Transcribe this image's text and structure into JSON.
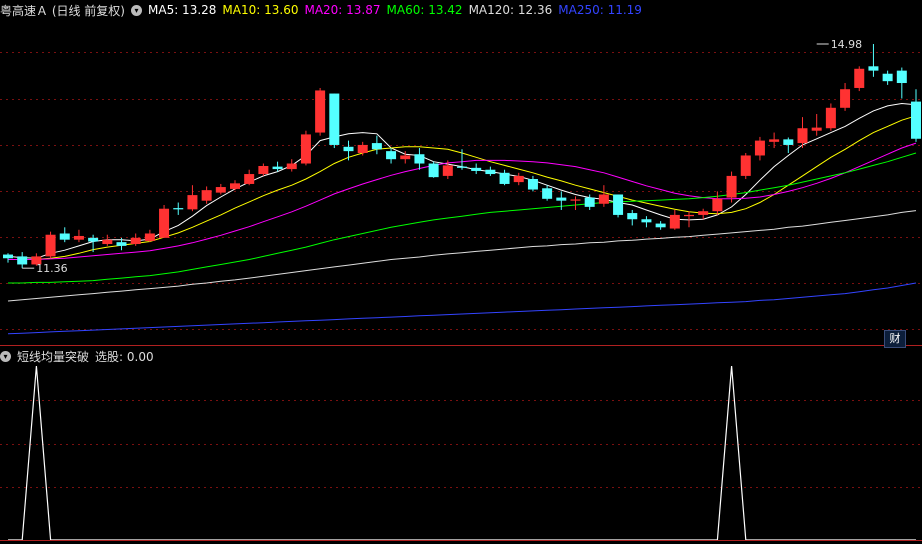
{
  "main_header": {
    "title": "粤高速Ａ (日线 前复权)",
    "ma_labels": [
      {
        "text": "MA5: 13.28",
        "color": "#ffffff"
      },
      {
        "text": "MA10: 13.60",
        "color": "#ffff00"
      },
      {
        "text": "MA20: 13.87",
        "color": "#ff00ff"
      },
      {
        "text": "MA60: 13.42",
        "color": "#00ff00"
      },
      {
        "text": "MA120: 12.36",
        "color": "#dddddd"
      },
      {
        "text": "MA250: 11.19",
        "color": "#3344ff"
      }
    ]
  },
  "sub_header": {
    "title": "短线均量突破",
    "value_text": "选股: 0.00"
  },
  "fin_tag": "财",
  "chart_data": [
    {
      "type": "candlestick",
      "ylim": [
        10.2,
        15.4
      ],
      "colors": {
        "up": "#ff3232",
        "down": "#54ffff",
        "flat": "#ffffff"
      },
      "annotations": [
        {
          "text": "11.36",
          "index": 1,
          "value": 11.36
        },
        {
          "text": "14.98",
          "index": 57,
          "value": 14.98
        }
      ],
      "candles": [
        [
          11.58,
          11.52,
          11.6,
          11.45
        ],
        [
          11.55,
          11.42,
          11.62,
          11.36
        ],
        [
          11.42,
          11.55,
          11.6,
          11.4
        ],
        [
          11.55,
          11.9,
          11.95,
          11.52
        ],
        [
          11.92,
          11.82,
          12.02,
          11.78
        ],
        [
          11.82,
          11.88,
          11.98,
          11.78
        ],
        [
          11.85,
          11.79,
          11.9,
          11.62
        ],
        [
          11.75,
          11.82,
          11.9,
          11.72
        ],
        [
          11.78,
          11.72,
          11.85,
          11.65
        ],
        [
          11.75,
          11.85,
          11.92,
          11.72
        ],
        [
          11.8,
          11.92,
          11.98,
          11.78
        ],
        [
          11.85,
          12.32,
          12.38,
          11.85
        ],
        [
          12.33,
          12.31,
          12.42,
          12.22
        ],
        [
          12.31,
          12.54,
          12.7,
          12.28
        ],
        [
          12.45,
          12.62,
          12.68,
          12.4
        ],
        [
          12.58,
          12.67,
          12.72,
          12.55
        ],
        [
          12.64,
          12.73,
          12.78,
          12.62
        ],
        [
          12.72,
          12.88,
          12.95,
          12.7
        ],
        [
          12.88,
          13.01,
          13.05,
          12.85
        ],
        [
          13.0,
          12.96,
          13.08,
          12.92
        ],
        [
          12.96,
          13.05,
          13.12,
          12.92
        ],
        [
          13.05,
          13.52,
          13.58,
          13.02
        ],
        [
          13.55,
          14.23,
          14.27,
          13.5
        ],
        [
          14.18,
          13.35,
          14.18,
          13.3
        ],
        [
          13.32,
          13.25,
          13.42,
          13.1
        ],
        [
          13.22,
          13.35,
          13.4,
          13.18
        ],
        [
          13.38,
          13.28,
          13.5,
          13.2
        ],
        [
          13.25,
          13.12,
          13.3,
          13.05
        ],
        [
          13.12,
          13.18,
          13.25,
          13.05
        ],
        [
          13.2,
          13.05,
          13.3,
          12.95
        ],
        [
          13.05,
          12.83,
          13.08,
          12.82
        ],
        [
          12.85,
          13.02,
          13.1,
          12.8
        ],
        [
          13.0,
          12.98,
          13.28,
          12.95
        ],
        [
          12.98,
          12.93,
          13.05,
          12.88
        ],
        [
          12.95,
          12.88,
          13.0,
          12.85
        ],
        [
          12.9,
          12.72,
          12.95,
          12.7
        ],
        [
          12.75,
          12.85,
          12.9,
          12.7
        ],
        [
          12.8,
          12.63,
          12.85,
          12.6
        ],
        [
          12.65,
          12.48,
          12.7,
          12.45
        ],
        [
          12.5,
          12.45,
          12.6,
          12.3
        ],
        [
          12.45,
          12.47,
          12.52,
          12.3
        ],
        [
          12.5,
          12.35,
          12.55,
          12.3
        ],
        [
          12.4,
          12.55,
          12.7,
          12.35
        ],
        [
          12.55,
          12.22,
          12.55,
          12.18
        ],
        [
          12.25,
          12.15,
          12.3,
          12.05
        ],
        [
          12.15,
          12.1,
          12.2,
          12.02
        ],
        [
          12.08,
          12.02,
          12.12,
          11.98
        ],
        [
          12.0,
          12.22,
          12.3,
          11.98
        ],
        [
          12.2,
          12.22,
          12.28,
          12.02
        ],
        [
          12.22,
          12.28,
          12.32,
          12.15
        ],
        [
          12.28,
          12.48,
          12.6,
          12.22
        ],
        [
          12.5,
          12.85,
          12.92,
          12.42
        ],
        [
          12.85,
          13.18,
          13.22,
          12.8
        ],
        [
          13.18,
          13.42,
          13.48,
          13.1
        ],
        [
          13.4,
          13.44,
          13.55,
          13.3
        ],
        [
          13.44,
          13.35,
          13.47,
          13.22
        ],
        [
          13.38,
          13.62,
          13.8,
          13.3
        ],
        [
          13.58,
          13.63,
          13.85,
          13.5
        ],
        [
          13.62,
          13.95,
          14.02,
          13.58
        ],
        [
          13.95,
          14.25,
          14.35,
          13.9
        ],
        [
          14.27,
          14.58,
          14.62,
          14.22
        ],
        [
          14.62,
          14.55,
          14.98,
          14.45
        ],
        [
          14.5,
          14.38,
          14.55,
          14.32
        ],
        [
          14.55,
          14.35,
          14.6,
          14.1
        ],
        [
          14.05,
          13.45,
          14.25,
          13.4
        ]
      ],
      "moving_averages": [
        {
          "name": "MA5",
          "color": "#ffffff",
          "values": [
            11.55,
            11.53,
            11.52,
            11.6,
            11.65,
            11.72,
            11.79,
            11.82,
            11.82,
            11.8,
            11.83,
            11.95,
            12.05,
            12.2,
            12.37,
            12.51,
            12.64,
            12.75,
            12.85,
            12.92,
            13.02,
            13.18,
            13.42,
            13.48,
            13.53,
            13.55,
            13.53,
            13.3,
            13.2,
            13.18,
            13.08,
            13.04,
            13.0,
            12.95,
            12.92,
            12.88,
            12.84,
            12.78,
            12.7,
            12.62,
            12.55,
            12.5,
            12.47,
            12.42,
            12.38,
            12.3,
            12.22,
            12.15,
            12.14,
            12.15,
            12.22,
            12.35,
            12.55,
            12.78,
            13.0,
            13.18,
            13.35,
            13.45,
            13.55,
            13.65,
            13.78,
            13.9,
            13.98,
            14.02,
            14.0
          ]
        },
        {
          "name": "MA10",
          "color": "#ffff00",
          "values": [
            11.5,
            11.5,
            11.5,
            11.52,
            11.55,
            11.6,
            11.66,
            11.7,
            11.73,
            11.76,
            11.79,
            11.86,
            11.93,
            12.02,
            12.12,
            12.22,
            12.33,
            12.43,
            12.53,
            12.62,
            12.7,
            12.8,
            12.92,
            13.05,
            13.15,
            13.22,
            13.28,
            13.3,
            13.32,
            13.32,
            13.3,
            13.28,
            13.22,
            13.15,
            13.08,
            13.02,
            12.96,
            12.9,
            12.83,
            12.77,
            12.7,
            12.64,
            12.58,
            12.52,
            12.46,
            12.41,
            12.36,
            12.31,
            12.27,
            12.25,
            12.24,
            12.26,
            12.32,
            12.42,
            12.55,
            12.7,
            12.85,
            13.0,
            13.15,
            13.28,
            13.42,
            13.55,
            13.65,
            13.75,
            13.82
          ]
        },
        {
          "name": "MA20",
          "color": "#ff00ff",
          "values": [
            11.5,
            11.5,
            11.5,
            11.51,
            11.52,
            11.54,
            11.56,
            11.58,
            11.6,
            11.62,
            11.64,
            11.68,
            11.72,
            11.77,
            11.83,
            11.89,
            11.96,
            12.03,
            12.11,
            12.19,
            12.27,
            12.36,
            12.46,
            12.56,
            12.64,
            12.72,
            12.79,
            12.86,
            12.92,
            12.97,
            13.02,
            13.06,
            13.08,
            13.1,
            13.1,
            13.1,
            13.09,
            13.08,
            13.06,
            13.03,
            13.0,
            12.95,
            12.9,
            12.83,
            12.76,
            12.69,
            12.63,
            12.57,
            12.53,
            12.5,
            12.48,
            12.48,
            12.49,
            12.51,
            12.55,
            12.6,
            12.66,
            12.73,
            12.81,
            12.9,
            13.0,
            13.1,
            13.2,
            13.3,
            13.38
          ]
        },
        {
          "name": "MA60",
          "color": "#00ff00",
          "values": [
            11.12,
            11.12,
            11.13,
            11.13,
            11.14,
            11.15,
            11.16,
            11.18,
            11.2,
            11.22,
            11.24,
            11.27,
            11.3,
            11.34,
            11.38,
            11.42,
            11.46,
            11.5,
            11.55,
            11.6,
            11.65,
            11.7,
            11.76,
            11.82,
            11.87,
            11.92,
            11.97,
            12.02,
            12.06,
            12.1,
            12.14,
            12.17,
            12.2,
            12.23,
            12.26,
            12.28,
            12.3,
            12.32,
            12.34,
            12.36,
            12.38,
            12.4,
            12.42,
            12.43,
            12.44,
            12.45,
            12.46,
            12.47,
            12.48,
            12.5,
            12.52,
            12.55,
            12.58,
            12.62,
            12.66,
            12.7,
            12.75,
            12.8,
            12.85,
            12.9,
            12.96,
            13.02,
            13.08,
            13.15,
            13.22
          ]
        },
        {
          "name": "MA120",
          "color": "#dddddd",
          "values": [
            10.83,
            10.85,
            10.87,
            10.89,
            10.91,
            10.93,
            10.95,
            10.97,
            10.99,
            11.01,
            11.03,
            11.05,
            11.07,
            11.1,
            11.12,
            11.15,
            11.17,
            11.2,
            11.23,
            11.26,
            11.29,
            11.32,
            11.35,
            11.38,
            11.41,
            11.44,
            11.47,
            11.5,
            11.52,
            11.54,
            11.57,
            11.59,
            11.61,
            11.63,
            11.65,
            11.67,
            11.69,
            11.71,
            11.72,
            11.74,
            11.75,
            11.77,
            11.78,
            11.8,
            11.81,
            11.83,
            11.84,
            11.86,
            11.87,
            11.89,
            11.91,
            11.93,
            11.95,
            11.97,
            11.99,
            12.02,
            12.04,
            12.07,
            12.1,
            12.13,
            12.16,
            12.19,
            12.22,
            12.26,
            12.29
          ]
        },
        {
          "name": "MA250",
          "color": "#3344ff",
          "values": [
            10.3,
            10.31,
            10.32,
            10.33,
            10.34,
            10.35,
            10.36,
            10.37,
            10.38,
            10.39,
            10.4,
            10.41,
            10.42,
            10.43,
            10.44,
            10.45,
            10.46,
            10.47,
            10.48,
            10.49,
            10.5,
            10.51,
            10.52,
            10.53,
            10.54,
            10.55,
            10.56,
            10.57,
            10.58,
            10.59,
            10.6,
            10.61,
            10.62,
            10.63,
            10.64,
            10.65,
            10.66,
            10.67,
            10.68,
            10.69,
            10.7,
            10.71,
            10.72,
            10.73,
            10.74,
            10.75,
            10.76,
            10.77,
            10.78,
            10.79,
            10.8,
            10.81,
            10.82,
            10.84,
            10.85,
            10.87,
            10.89,
            10.91,
            10.93,
            10.95,
            10.98,
            11.01,
            11.04,
            11.08,
            11.12
          ]
        }
      ]
    },
    {
      "type": "line",
      "ylim": [
        0,
        1
      ],
      "series": [
        {
          "color": "#ffffff",
          "values": [
            0,
            0,
            1,
            0,
            0,
            0,
            0,
            0,
            0,
            0,
            0,
            0,
            0,
            0,
            0,
            0,
            0,
            0,
            0,
            0,
            0,
            0,
            0,
            0,
            0,
            0,
            0,
            0,
            0,
            0,
            0,
            0,
            0,
            0,
            0,
            0,
            0,
            0,
            0,
            0,
            0,
            0,
            0,
            0,
            0,
            0,
            0,
            0,
            0,
            0,
            0,
            1,
            0,
            0,
            0,
            0,
            0,
            0,
            0,
            0,
            0,
            0,
            0,
            0,
            0
          ]
        }
      ]
    }
  ]
}
